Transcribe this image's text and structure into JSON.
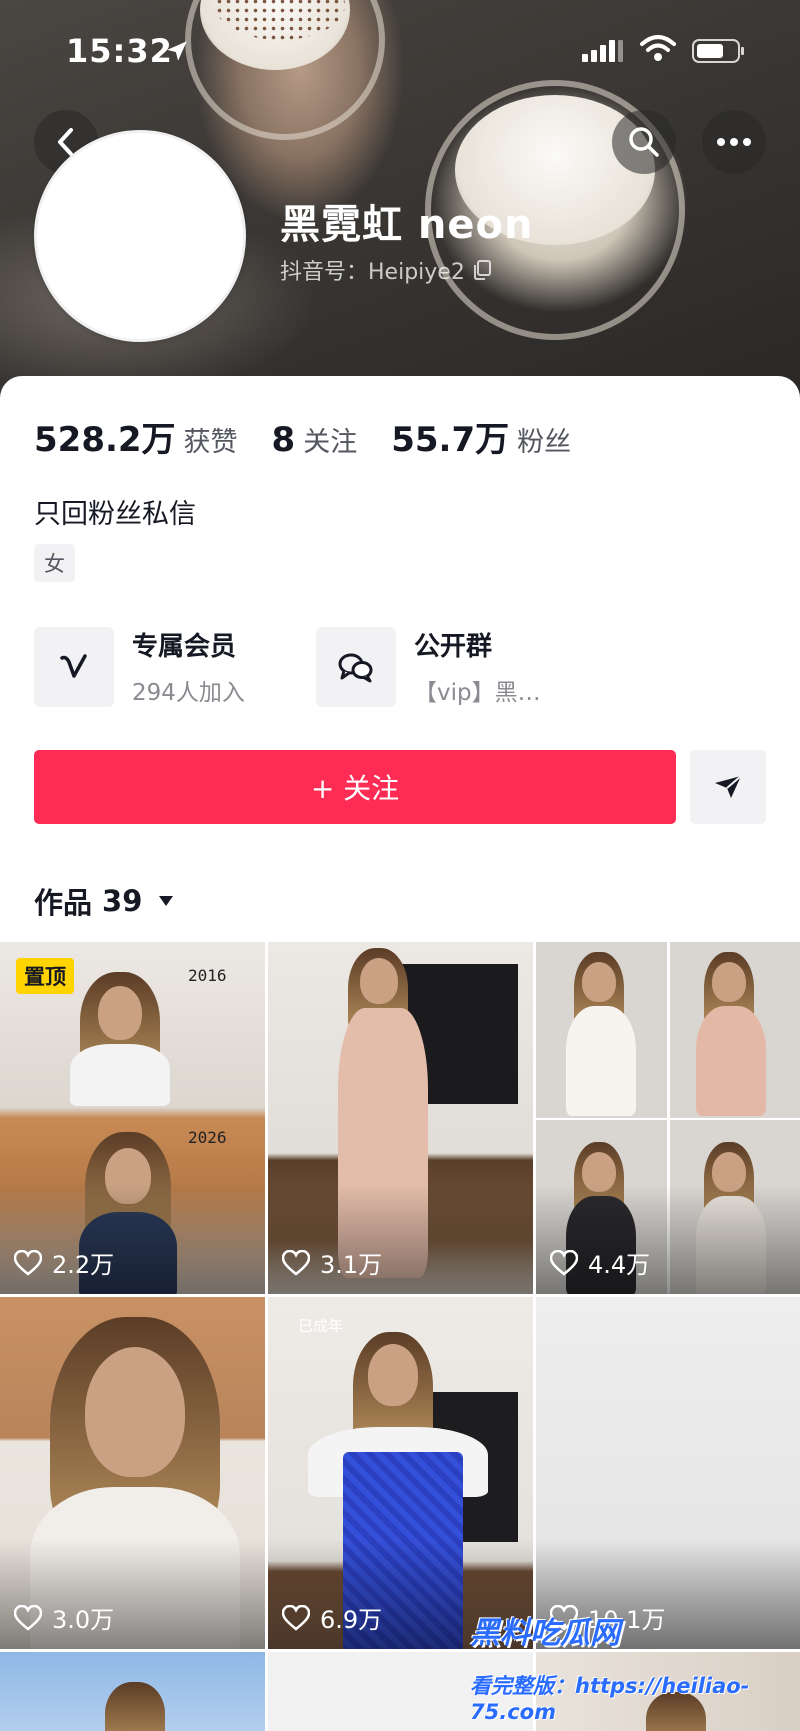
{
  "status_bar": {
    "time": "15:32"
  },
  "profile": {
    "nickname": "黑霓虹 neon",
    "douyin_id": "抖音号：Heipiye2",
    "bio": "只回粉丝私信",
    "gender_tag": "女"
  },
  "stats": [
    {
      "value": "528.2万",
      "label": "获赞"
    },
    {
      "value": "8",
      "label": "关注"
    },
    {
      "value": "55.7万",
      "label": "粉丝"
    }
  ],
  "entries": {
    "member": {
      "title": "专属会员",
      "subtitle": "294人加入"
    },
    "group": {
      "title": "公开群",
      "subtitle": "【vip】黑…"
    }
  },
  "actions": {
    "follow_label": "+ 关注"
  },
  "works_tab": {
    "label": "作品",
    "count": "39"
  },
  "videos": [
    {
      "likes": "2.2万",
      "pinned_label": "置顶",
      "year_top": "2016",
      "year_bottom": "2026"
    },
    {
      "likes": "3.1万"
    },
    {
      "likes": "4.4万"
    },
    {
      "likes": "3.0万"
    },
    {
      "likes": "6.9万",
      "overlay_text": "已成年"
    },
    {
      "likes": "10.1万"
    }
  ],
  "watermark": {
    "line1": "黑料吃瓜网",
    "line2": "看完整版：https://heiliao-75.com"
  },
  "colors": {
    "accent": "#fe2c55",
    "pin": "#ffd400"
  }
}
